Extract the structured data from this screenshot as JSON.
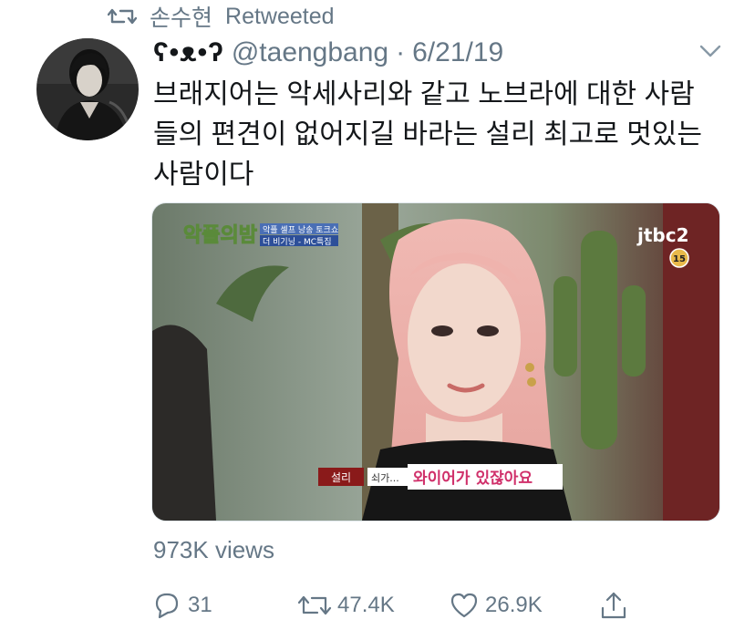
{
  "retweet_context": {
    "icon": "retweet-icon",
    "user": "손수현",
    "label": "Retweeted"
  },
  "tweet": {
    "display_name": "ʕ•ᴥ•ʔ",
    "handle": "@taengbang",
    "separator": "·",
    "date": "6/21/19",
    "text_lines": [
      "브래지어는 악세사리와 같고 노브라에 대한 사람",
      "들의 편견이 없어지길 바라는 설리 최고로 멋있는",
      "사람이다"
    ],
    "media": {
      "show_logo": "악플의밤",
      "tag_top": "악플 셀프 낭송 토크쇼",
      "tag_bottom": "더 비기닝 - MC특집",
      "channel_logo": "jtbc2",
      "rating": "15",
      "caption_name": "설리",
      "caption_prefix": "쇠가...",
      "caption_main": "와이어가 있잖아요"
    },
    "views": "973K views",
    "actions": {
      "reply_count": "31",
      "retweet_count": "47.4K",
      "like_count": "26.9K"
    }
  },
  "colors": {
    "text_primary": "#14171a",
    "text_secondary": "#657786",
    "border": "#e1e8ed"
  }
}
